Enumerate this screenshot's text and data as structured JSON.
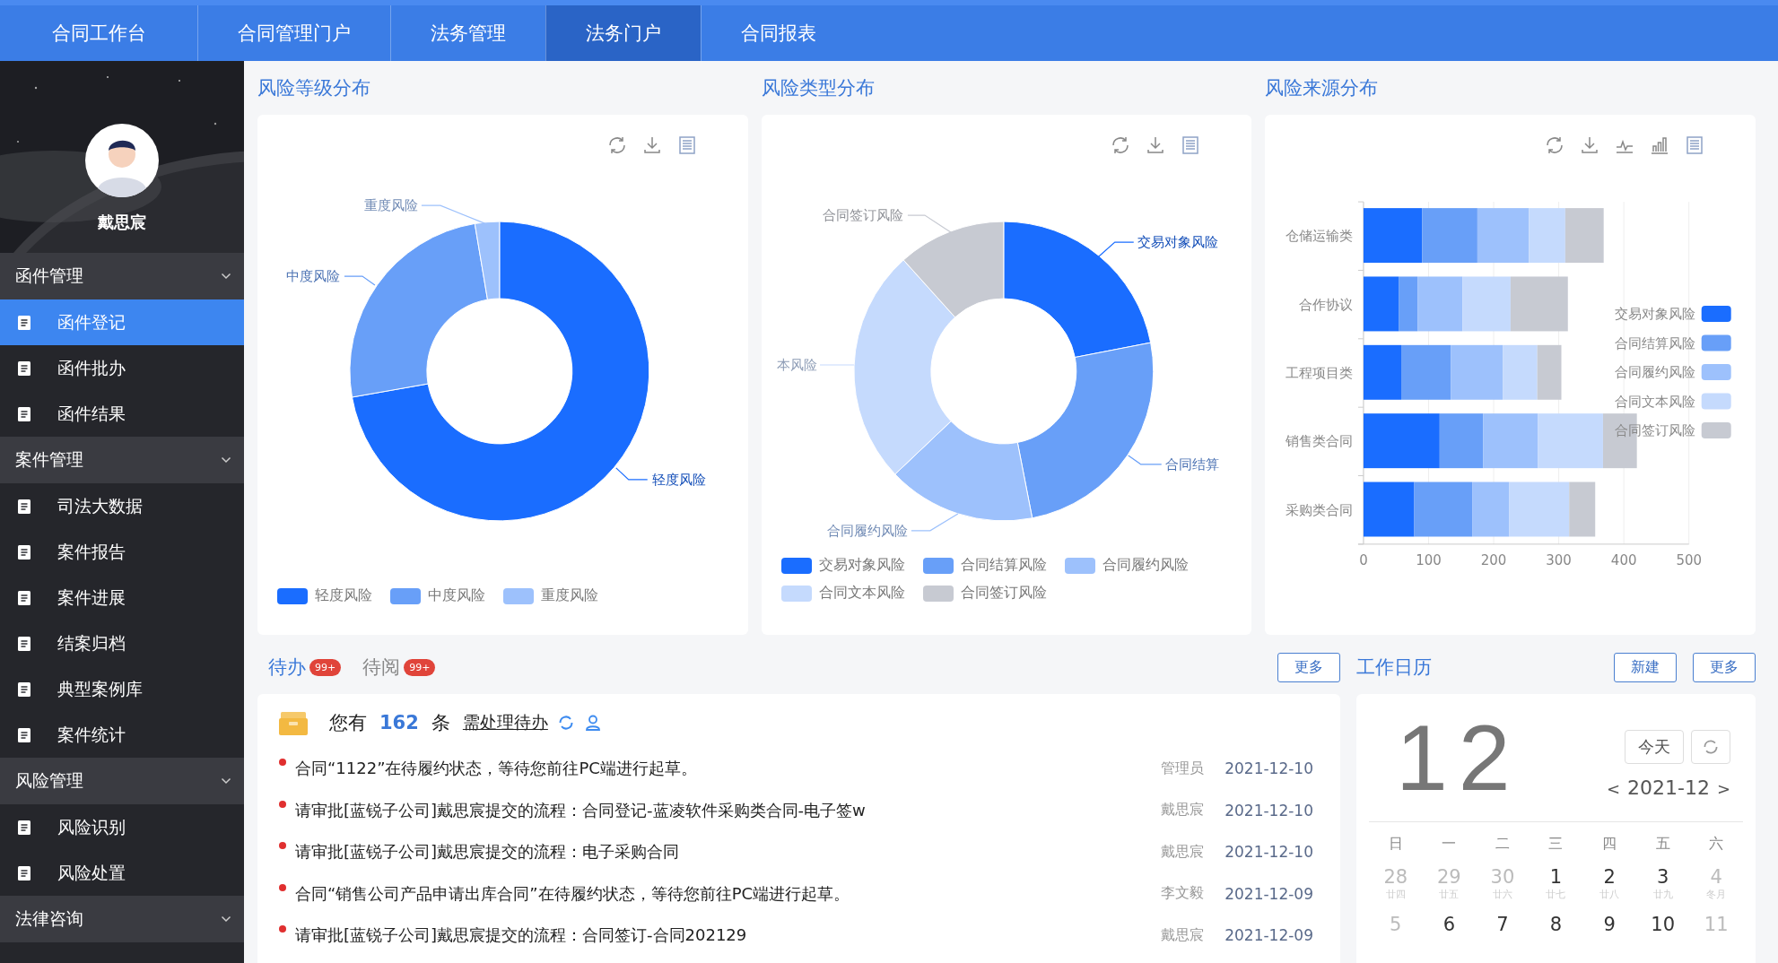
{
  "nav": {
    "tabs": [
      {
        "label": "合同工作台",
        "selected": false
      },
      {
        "label": "合同管理门户",
        "selected": false
      },
      {
        "label": "法务管理",
        "selected": false
      },
      {
        "label": "法务门户",
        "selected": true
      },
      {
        "label": "合同报表",
        "selected": false
      }
    ]
  },
  "sidebar": {
    "user": {
      "name": "戴思宸"
    },
    "groups": [
      {
        "title": "函件管理",
        "items": [
          {
            "label": "函件登记",
            "selected": true
          },
          {
            "label": "函件批办",
            "selected": false
          },
          {
            "label": "函件结果",
            "selected": false
          }
        ]
      },
      {
        "title": "案件管理",
        "items": [
          {
            "label": "司法大数据",
            "selected": false
          },
          {
            "label": "案件报告",
            "selected": false
          },
          {
            "label": "案件进展",
            "selected": false
          },
          {
            "label": "结案归档",
            "selected": false
          },
          {
            "label": "典型案例库",
            "selected": false
          },
          {
            "label": "案件统计",
            "selected": false
          }
        ]
      },
      {
        "title": "风险管理",
        "items": [
          {
            "label": "风险识别",
            "selected": false
          },
          {
            "label": "风险处置",
            "selected": false
          }
        ]
      },
      {
        "title": "法律咨询"
      }
    ]
  },
  "charts": [
    {
      "kind": "donut",
      "title": "风险等级分布",
      "slices": [
        {
          "label": "轻度风险",
          "color": "#1a6dff"
        },
        {
          "label": "中度风险",
          "color": "#689ff8"
        },
        {
          "label": "重度风险",
          "color": "#9dc1fc"
        }
      ],
      "legend": [
        {
          "label": "轻度风险",
          "color": "#1a6dff"
        },
        {
          "label": "中度风险",
          "color": "#689ff8"
        },
        {
          "label": "重度风险",
          "color": "#9dc1fc"
        }
      ]
    },
    {
      "kind": "donut",
      "title": "风险类型分布",
      "slices": [
        {
          "label": "交易对象风险",
          "color": "#1a6dff"
        },
        {
          "label": "合同结算",
          "color": "#689ff8"
        },
        {
          "label": "合同履约风险",
          "color": "#9dc1fc"
        },
        {
          "label": "本风险",
          "color": "#c5dafd"
        },
        {
          "label": "合同签订风险",
          "color": "#c7cad2"
        }
      ],
      "legend": [
        {
          "label": "交易对象风险",
          "color": "#1a6dff"
        },
        {
          "label": "合同结算风险",
          "color": "#689ff8"
        },
        {
          "label": "合同履约风险",
          "color": "#9dc1fc"
        },
        {
          "label": "合同文本风险",
          "color": "#c5dafd"
        },
        {
          "label": "合同签订风险",
          "color": "#c7cad2"
        }
      ]
    },
    {
      "kind": "bar",
      "title": "风险来源分布",
      "chart_data": {
        "type": "bar",
        "orientation": "horizontal",
        "stacked": true,
        "categories": [
          "仓储运输类",
          "合作协议",
          "工程项目类",
          "销售类合同",
          "采购类合同"
        ],
        "series": [
          {
            "name": "交易对象风险",
            "color": "#1a6dff",
            "values": [
              90,
              54,
              58,
              117,
              78
            ]
          },
          {
            "name": "合同结算风险",
            "color": "#689ff8",
            "values": [
              85,
              29,
              76,
              67,
              89
            ]
          },
          {
            "name": "合同履约风险",
            "color": "#9dc1fc",
            "values": [
              79,
              69,
              80,
              84,
              57
            ]
          },
          {
            "name": "合同文本风险",
            "color": "#c5dafd",
            "values": [
              56,
              74,
              53,
              100,
              92
            ]
          },
          {
            "name": "合同签订风险",
            "color": "#c7cad2",
            "values": [
              59,
              88,
              37,
              52,
              40
            ]
          }
        ],
        "xlim": [
          0,
          500
        ],
        "xticks": [
          0,
          100,
          200,
          300,
          400,
          500
        ],
        "grid": true,
        "legend": true
      }
    }
  ],
  "todo": {
    "tabs": [
      {
        "label": "待办",
        "badge": "99+",
        "selected": true
      },
      {
        "label": "待阅",
        "badge": "99+",
        "selected": false
      }
    ],
    "more": "更多",
    "summary": {
      "prefix": "您有",
      "count": "162",
      "unit": "条",
      "link": "需处理待办"
    },
    "items": [
      {
        "text": "合同“1122”在待履约状态，等待您前往PC端进行起草。",
        "author": "管理员",
        "date": "2021-12-10"
      },
      {
        "text": "请审批[蓝锐子公司]戴思宸提交的流程：合同登记-蓝凌软件采购类合同-电子签w",
        "author": "戴思宸",
        "date": "2021-12-10"
      },
      {
        "text": "请审批[蓝锐子公司]戴思宸提交的流程：电子采购合同",
        "author": "戴思宸",
        "date": "2021-12-10"
      },
      {
        "text": "合同“销售公司产品申请出库合同”在待履约状态，等待您前往PC端进行起草。",
        "author": "李文毅",
        "date": "2021-12-09"
      },
      {
        "text": "请审批[蓝锐子公司]戴思宸提交的流程：合同签订-合同202129",
        "author": "戴思宸",
        "date": "2021-12-09"
      }
    ]
  },
  "calendar": {
    "title": "工作日历",
    "buttons": [
      "新建",
      "更多"
    ],
    "day": "12",
    "today": "今天",
    "prev": "<",
    "month": "2021-12",
    "next": ">",
    "weekdays": [
      "日",
      "一",
      "二",
      "三",
      "四",
      "五",
      "六"
    ],
    "weeks": [
      [
        {
          "day": "28",
          "lunar": "廿四",
          "muted": true
        },
        {
          "day": "29",
          "lunar": "廿五",
          "muted": true
        },
        {
          "day": "30",
          "lunar": "廿六",
          "muted": true
        },
        {
          "day": "1",
          "lunar": "廿七",
          "muted": false
        },
        {
          "day": "2",
          "lunar": "廿八",
          "muted": false
        },
        {
          "day": "3",
          "lunar": "廿九",
          "muted": false
        },
        {
          "day": "4",
          "lunar": "冬月",
          "muted": true
        }
      ],
      [
        {
          "day": "5",
          "muted": true
        },
        {
          "day": "6",
          "muted": false
        },
        {
          "day": "7",
          "muted": false
        },
        {
          "day": "8",
          "muted": false
        },
        {
          "day": "9",
          "muted": false
        },
        {
          "day": "10",
          "muted": false
        },
        {
          "day": "11",
          "muted": true
        }
      ]
    ]
  }
}
